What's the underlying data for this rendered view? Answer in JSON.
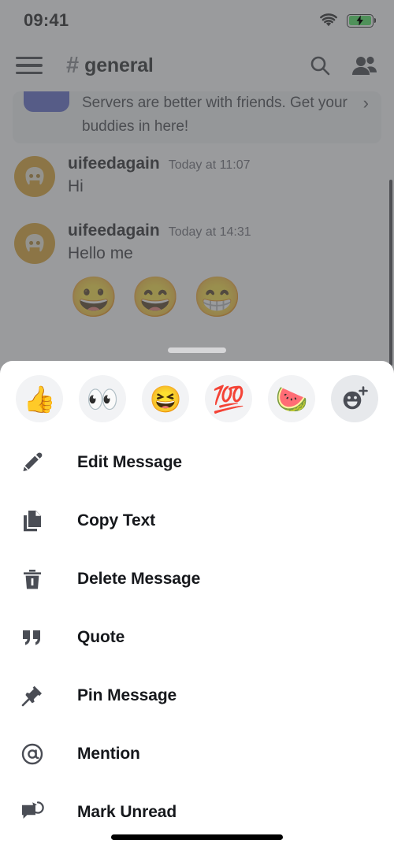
{
  "status_bar": {
    "time": "09:41",
    "wifi_icon": "wifi-icon",
    "battery_icon": "battery-charging-icon",
    "battery_color": "#3CE44F",
    "charging": true
  },
  "header": {
    "menu_icon": "hamburger-menu-icon",
    "hash_symbol": "#",
    "channel_name": "general",
    "search_icon": "search-icon",
    "members_icon": "members-icon"
  },
  "invite_banner": {
    "icon": "server-invite-icon",
    "text": "Servers are better with friends. Get your buddies in here!",
    "chevron": "›",
    "accent_color": "#4E5AC4"
  },
  "messages": [
    {
      "avatar_icon": "discord-clyde-avatar",
      "avatar_color": "#D99B1C",
      "author": "uifeedagain",
      "timestamp": "Today at 11:07",
      "text": "Hi",
      "jumbo_emoji": []
    },
    {
      "avatar_icon": "discord-clyde-avatar",
      "avatar_color": "#D99B1C",
      "author": "uifeedagain",
      "timestamp": "Today at 14:31",
      "text": "Hello me",
      "jumbo_emoji": [
        "😀",
        "😄",
        "😁"
      ]
    }
  ],
  "action_sheet": {
    "drag_handle": "drag-handle",
    "quick_reactions": [
      {
        "name": "reaction-thumbsup",
        "emoji": "👍",
        "label": "thumbs up"
      },
      {
        "name": "reaction-eyes",
        "emoji": "👀",
        "label": "eyes"
      },
      {
        "name": "reaction-laughing",
        "emoji": "😆",
        "label": "laughing"
      },
      {
        "name": "reaction-hundred",
        "emoji": "💯",
        "label": "hundred"
      },
      {
        "name": "reaction-watermelon",
        "emoji": "🍉",
        "label": "watermelon"
      }
    ],
    "add_reaction": {
      "name": "add-reaction-button",
      "label": "Add Reaction"
    },
    "menu_items": [
      {
        "icon": "pencil-icon",
        "label": "Edit Message"
      },
      {
        "icon": "copy-icon",
        "label": "Copy Text"
      },
      {
        "icon": "trash-icon",
        "label": "Delete Message"
      },
      {
        "icon": "quote-icon",
        "label": "Quote"
      },
      {
        "icon": "pin-icon",
        "label": "Pin Message"
      },
      {
        "icon": "mention-icon",
        "label": "Mention"
      },
      {
        "icon": "mark-unread-icon",
        "label": "Mark Unread"
      }
    ]
  },
  "home_indicator": "home-indicator"
}
